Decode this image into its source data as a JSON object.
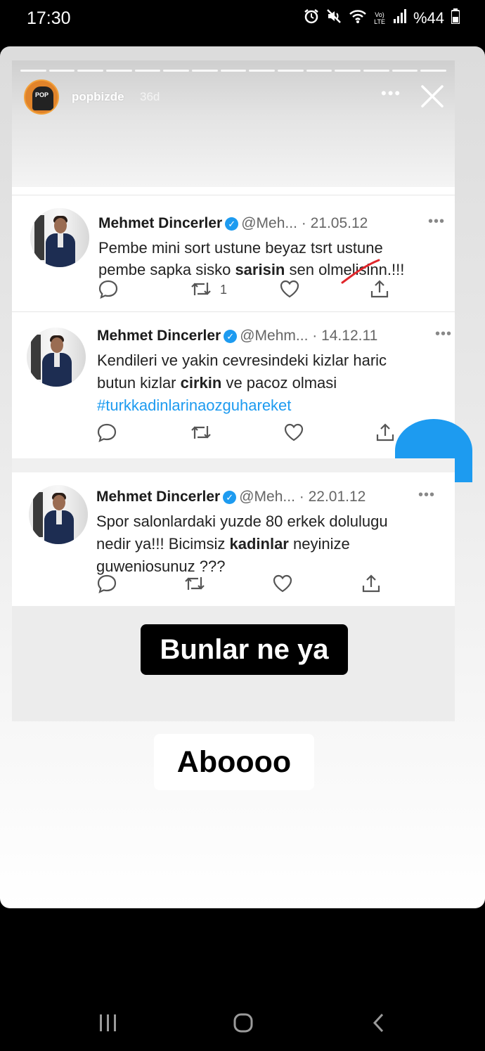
{
  "status_bar": {
    "time": "17:30",
    "volte": "Vo)",
    "lte": "LTE",
    "battery": "%44",
    "icons": [
      "alarm-icon",
      "mute-icon",
      "wifi-icon",
      "signal-icon",
      "battery-icon"
    ]
  },
  "story": {
    "username": "popbizde",
    "age": "36d",
    "avatar_text": "POP",
    "more_label": "•••",
    "progress_segments": 15
  },
  "tweets": [
    {
      "name": "Mehmet Dincerler",
      "handle": "@Meh...",
      "date": "· 21.05.12",
      "line1": "Pembe mini sort ustune beyaz tsrt ustune",
      "line2_a": "pembe sapka sisko ",
      "line2_b": "sarisin",
      "line2_c": " sen olmelisinn.!!!",
      "retweets": "1",
      "more": "•••"
    },
    {
      "name": "Mehmet Dincerler",
      "handle": "@Mehm...",
      "date": "· 14.12.11",
      "line1": "Kendileri ve yakin cevresindeki kizlar haric",
      "line2_a": "butun kizlar ",
      "line2_b": "cirkin",
      "line2_c": " ve pacoz olmasi",
      "hashtag": "#turkkadinlarinaozguhareket",
      "more": "•••"
    },
    {
      "name": "Mehmet Dincerler",
      "handle": "@Meh...",
      "date": "· 22.01.12",
      "line1": "Spor salonlardaki yuzde 80 erkek dolulugu",
      "line2_a": "nedir ya!!! Bicimsiz ",
      "line2_b": "kadinlar",
      "line2_c": " neyinize",
      "line3": "guweniosunuz ???",
      "more": "•••"
    }
  ],
  "captions": {
    "first": "Bunlar ne ya",
    "second": "Aboooo"
  },
  "colors": {
    "twitter_blue": "#1d9bf0",
    "caption_black": "#000000",
    "annotation_red": "#e0262b"
  }
}
